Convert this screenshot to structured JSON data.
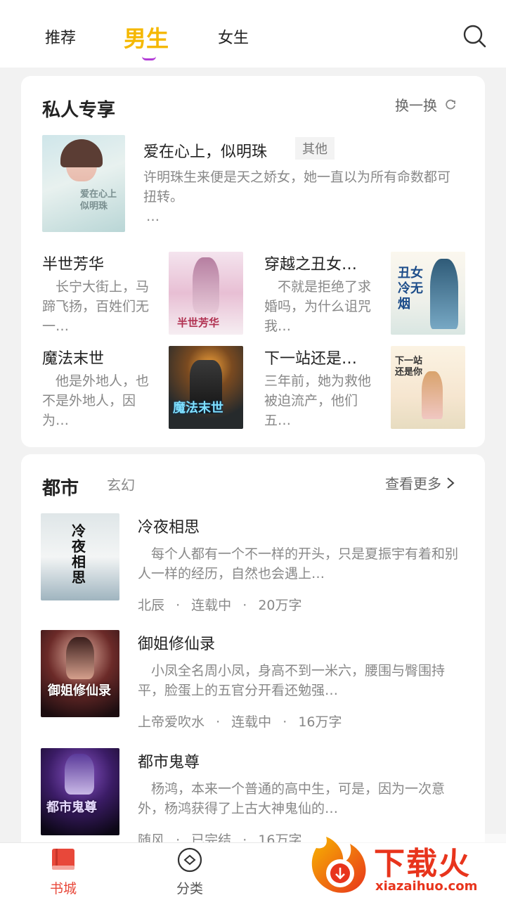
{
  "top_tabs": [
    {
      "label": "推荐"
    },
    {
      "label": "男生"
    },
    {
      "label": "女生"
    }
  ],
  "private": {
    "title": "私人专享",
    "refresh_label": "换一换",
    "featured": {
      "title": "爱在心上，似明珠",
      "tag": "其他",
      "desc": "许明珠生来便是天之娇女，她一直以为所有命数都可扭转。",
      "ellipsis": "…",
      "cover_text": "爱在心上\n似明珠"
    },
    "grid": [
      {
        "title": "半世芳华",
        "desc": "　长宁大街上，马蹄飞扬，百姓们无一…",
        "cover_text": "半世芳华"
      },
      {
        "title": "穿越之丑女…",
        "desc": "　不就是拒绝了求婚吗，为什么诅咒我…",
        "cover_text": "丑女冷无烟"
      },
      {
        "title": "魔法末世",
        "desc": "　他是外地人，也不是外地人，因为…",
        "cover_text": "魔法末世"
      },
      {
        "title": "下一站还是…",
        "desc": "三年前，她为救他被迫流产，他们五…",
        "cover_text": "下一站还是你"
      }
    ]
  },
  "section": {
    "tab_active": "都市",
    "tab_other": "玄幻",
    "more_label": "查看更多",
    "books": [
      {
        "title": "冷夜相思",
        "desc": "　每个人都有一个不一样的开头，只是夏振宇有着和别人一样的经历，自然也会遇上…",
        "author": "北辰",
        "status": "连载中",
        "words": "20万字",
        "cover_text": "冷夜相思"
      },
      {
        "title": "御姐修仙录",
        "desc": "　小凤全名周小凤，身高不到一米六，腰围与臀围持平，脸蛋上的五官分开看还勉强…",
        "author": "上帝爱吹水",
        "status": "连载中",
        "words": "16万字",
        "cover_text": "御姐修仙录"
      },
      {
        "title": "都市鬼尊",
        "desc": "　杨鸿，本来一个普通的高中生，可是，因为一次意外，杨鸿获得了上古大神鬼仙的…",
        "author": "随风",
        "status": "已完结",
        "words": "16万字",
        "cover_text": "都市鬼尊"
      }
    ]
  },
  "bottom_nav": [
    {
      "label": "书城",
      "icon": "book-icon"
    },
    {
      "label": "分类",
      "icon": "category-icon"
    }
  ],
  "watermark": {
    "text": "下载火",
    "url": "xiazaihuo.com"
  },
  "colors": {
    "accent": "#f5b800",
    "active_nav": "#e8483a",
    "underline": "#b23bd6"
  }
}
